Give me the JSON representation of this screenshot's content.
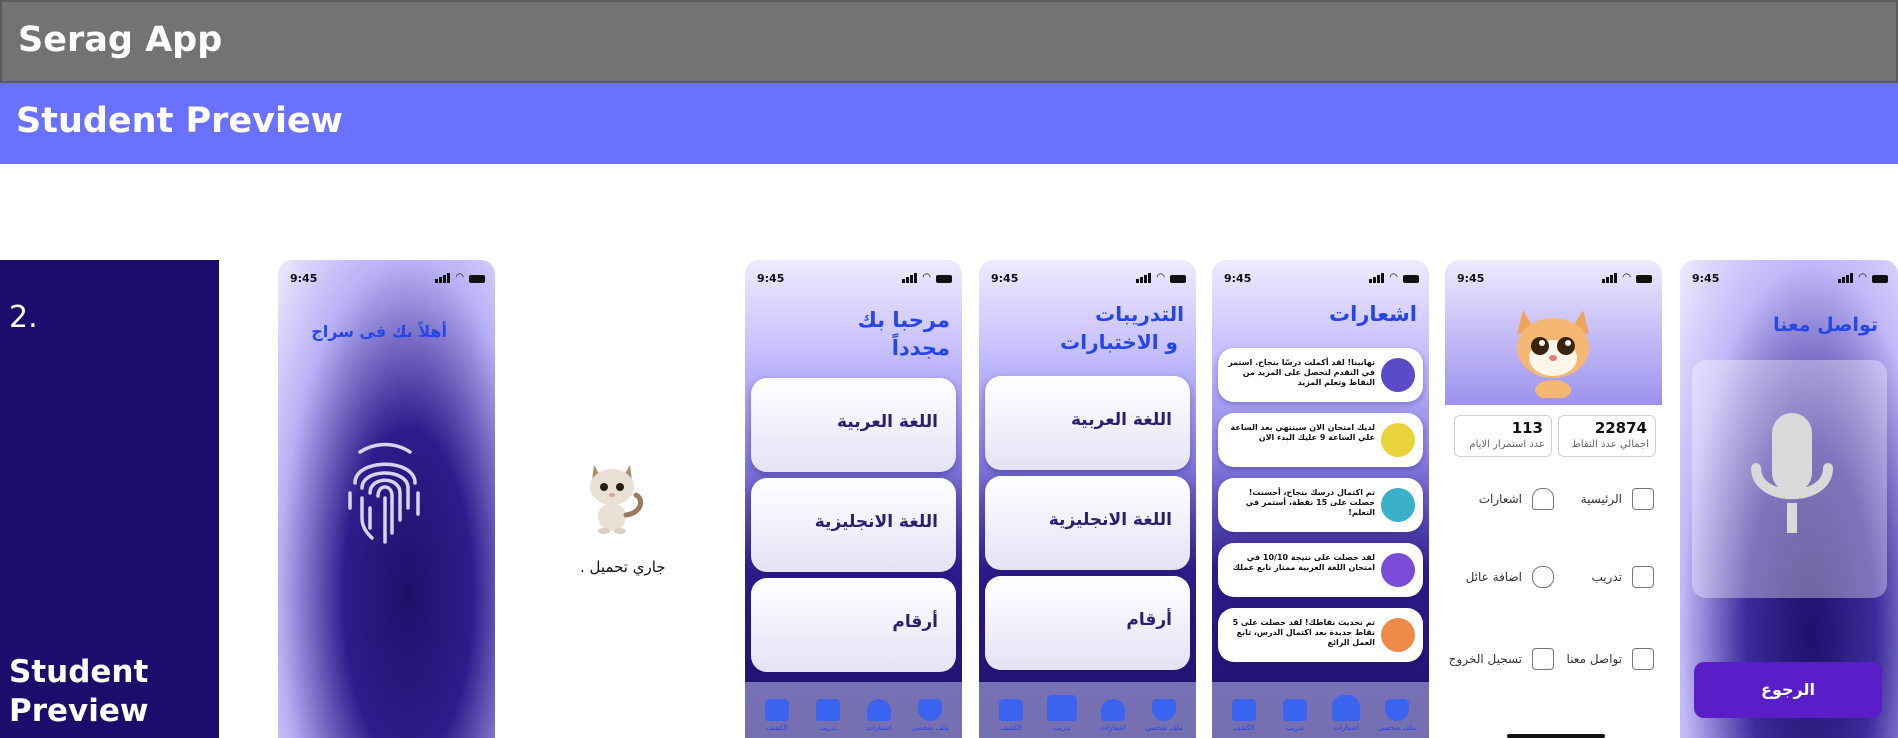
{
  "app": {
    "title": "Serag App",
    "subtitle": "Student Preview"
  },
  "left_panel": {
    "number": "2.",
    "caption": "Student Preview"
  },
  "status": {
    "time": "9:45"
  },
  "screen1": {
    "title": "أهلاً بك فى سراج"
  },
  "screen2": {
    "loading": "جاري تحميل ."
  },
  "screen3": {
    "title_line1": "مرحبا بك",
    "title_line2": "مجدداً",
    "cards": [
      "اللغة العربية",
      "اللغة الانجليزية",
      "أرقام"
    ],
    "nav": [
      "الكشف",
      "تدريب",
      "اشعارات",
      "ملف شخصي"
    ]
  },
  "screen4": {
    "title_line1": "التدريبات",
    "title_line2": "و الاختبارات",
    "cards": [
      "اللغة العربية",
      "اللغة الانجليزية",
      "أرقام"
    ],
    "nav": [
      "الكشف",
      "تدريب",
      "اشعارات",
      "ملف شخصي"
    ]
  },
  "screen5": {
    "title": "اشعارات",
    "notifications": [
      "تهانينا! لقد أكملت درسًا بنجاح. استمر في التقدم لتحصل على المزيد من النقاط وتعلم المزيد",
      "لديك امتحان الان سينتهي بعد الساعة علي الساعة 9 عليك البدء الان",
      "تم اكتمال درسك بنجاح، أحسنت! حصلت على 15 نقطة، أستمر في التعلم!",
      "لقد حصلت على نتيجة 10/10 في امتحان اللغة العربية ممتاز تابع عملك",
      "تم تحديث نقاطك! لقد حصلت على 5 نقاط جديدة بعد اكتمال الدرس، تابع العمل الرائع"
    ],
    "nav": [
      "الكشف",
      "تدريب",
      "اشعارات",
      "ملف شخصي"
    ]
  },
  "screen6": {
    "points_value": "22874",
    "points_label": "اجمالي عدد النقاط",
    "streak_value": "113",
    "streak_label": "عدد استمرار الايام",
    "menu": [
      "الرئيسية",
      "اشعارات",
      "تدريب",
      "اضافة عائل",
      "تواصل معنا",
      "تسجيل الخروج"
    ]
  },
  "screen7": {
    "title": "تواصل معنا",
    "back": "الرجوع"
  },
  "colors": {
    "accent": "#6a70ff",
    "dark": "#1c0c6b",
    "button": "#5a1ec8",
    "title_blue": "#2546e8"
  }
}
